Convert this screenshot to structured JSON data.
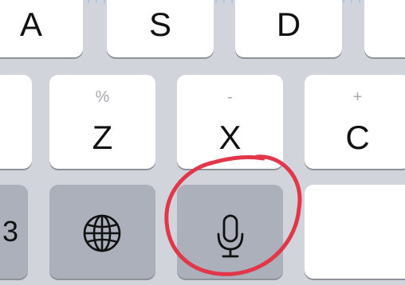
{
  "keyboard": {
    "row1": {
      "a": "A",
      "s": "S",
      "d": "D"
    },
    "row2": {
      "z": "Z",
      "z_alt": "%",
      "x": "X",
      "x_alt": "-",
      "c": "C",
      "c_alt": "+"
    },
    "row3": {
      "left_partial": "3",
      "globe": "globe-icon",
      "dictation": "microphone-icon",
      "space": ""
    }
  },
  "annotation": {
    "color": "#e2374b",
    "target": "dictation-key"
  }
}
